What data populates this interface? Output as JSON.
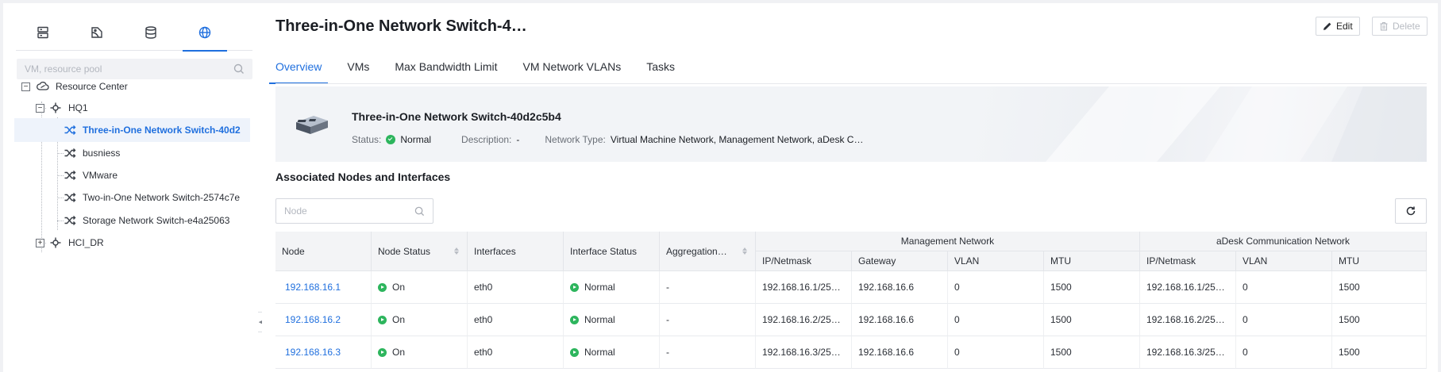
{
  "sidebar": {
    "tabs": [
      {
        "icon": "server-icon",
        "active": false
      },
      {
        "icon": "storage-policy-icon",
        "active": false
      },
      {
        "icon": "database-icon",
        "active": false
      },
      {
        "icon": "globe-network-icon",
        "active": true
      }
    ],
    "search_placeholder": "VM, resource pool",
    "tree": {
      "root": "Resource Center",
      "hq1": "HQ1",
      "items": [
        "Three-in-One Network Switch-40d2",
        "busniess",
        "VMware",
        "Two-in-One Network Switch-2574c7e",
        "Storage Network Switch-e4a25063"
      ],
      "hci": "HCI_DR",
      "selected_index": 0
    }
  },
  "header": {
    "title": "Three-in-One Network Switch-4…",
    "edit_label": "Edit",
    "delete_label": "Delete"
  },
  "tabs": [
    "Overview",
    "VMs",
    "Max Bandwidth Limit",
    "VM Network VLANs",
    "Tasks"
  ],
  "summary": {
    "name": "Three-in-One Network Switch-40d2c5b4",
    "status_label": "Status:",
    "status_value": "Normal",
    "description_label": "Description:",
    "description_value": "-",
    "network_type_label": "Network Type:",
    "network_type_value": "Virtual Machine Network, Management Network, aDesk C…"
  },
  "section_title": "Associated Nodes and Interfaces",
  "node_search_placeholder": "Node",
  "table": {
    "headers": {
      "node": "Node",
      "node_status": "Node Status",
      "interfaces": "Interfaces",
      "interface_status": "Interface Status",
      "aggregation": "Aggregation…",
      "mgmt_group": "Management Network",
      "adesk_group": "aDesk Communication Network",
      "ip_netmask": "IP/Netmask",
      "gateway": "Gateway",
      "vlan": "VLAN",
      "mtu": "MTU"
    },
    "rows": [
      {
        "node": "192.168.16.1",
        "node_status": "On",
        "interface": "eth0",
        "interface_status": "Normal",
        "aggregation": "-",
        "mgmt_ip": "192.168.16.1/25…",
        "mgmt_gateway": "192.168.16.6",
        "mgmt_vlan": "0",
        "mgmt_mtu": "1500",
        "adesk_ip": "192.168.16.1/25…",
        "adesk_vlan": "0",
        "adesk_mtu": "1500"
      },
      {
        "node": "192.168.16.2",
        "node_status": "On",
        "interface": "eth0",
        "interface_status": "Normal",
        "aggregation": "-",
        "mgmt_ip": "192.168.16.2/25…",
        "mgmt_gateway": "192.168.16.6",
        "mgmt_vlan": "0",
        "mgmt_mtu": "1500",
        "adesk_ip": "192.168.16.2/25…",
        "adesk_vlan": "0",
        "adesk_mtu": "1500"
      },
      {
        "node": "192.168.16.3",
        "node_status": "On",
        "interface": "eth0",
        "interface_status": "Normal",
        "aggregation": "-",
        "mgmt_ip": "192.168.16.3/25…",
        "mgmt_gateway": "192.168.16.6",
        "mgmt_vlan": "0",
        "mgmt_mtu": "1500",
        "adesk_ip": "192.168.16.3/25…",
        "adesk_vlan": "0",
        "adesk_mtu": "1500"
      }
    ]
  },
  "colors": {
    "accent": "#1f6fde",
    "status_green": "#2db55d"
  }
}
